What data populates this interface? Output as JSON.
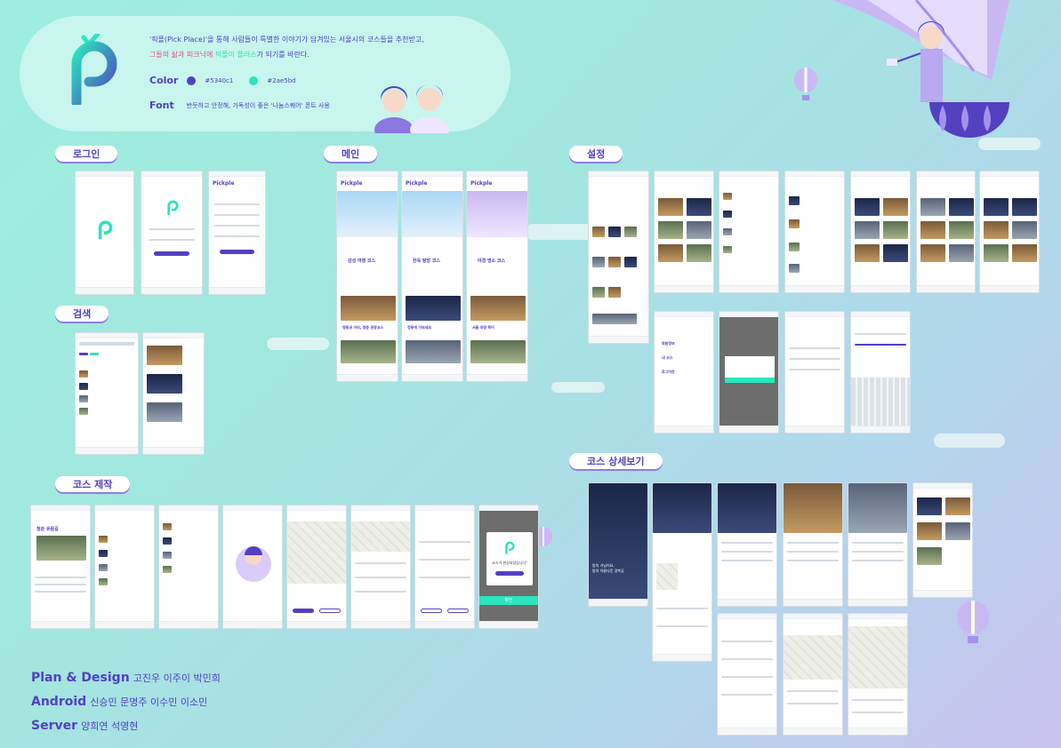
{
  "header": {
    "intro_line1": "'픽플(Pick Place)'을 통해 사람들이 특별한 이야기가 담겨있는 서울시의 코스들을 추천받고,",
    "intro_line2_a": "그들의 삶과 피크닉에 ",
    "intro_line2_b": "픽플이 플러스",
    "intro_line2_c": "가 되기를 바란다.",
    "color_label": "Color",
    "color_primary": "#5340c1",
    "color_secondary": "#2ae5bd",
    "font_label": "Font",
    "font_desc": "반듯하고 안정해, 가독성이 좋은 '나눔스퀘어' 폰트 사용"
  },
  "sections": {
    "login": "로그인",
    "main": "메인",
    "settings": "설정",
    "search": "검색",
    "course_make": "코스 제작",
    "course_detail": "코스 상세보기"
  },
  "app": {
    "logo_text": "Pickple",
    "main_cards": [
      "감성 여행 코스",
      "한옥 탐방 코스",
      "야경 명소 코스"
    ],
    "main_list": [
      "명동과 거리, 청춘 관광코스",
      "정동에 가보세요",
      "서울 야경 투어",
      "한옥 감성 코스"
    ],
    "detail_hero_line1": "밤의 거닐어요,",
    "detail_hero_line2": "밤의 아름다운 경복궁",
    "course_title": "청춘 유람길",
    "dialog_text": "코스가 완성되었습니다!",
    "dialog_button": "확인",
    "settings_menu": [
      "회원정보",
      "내 코스",
      "로그아웃"
    ]
  },
  "credits": [
    {
      "role": "Plan & Design",
      "names": "고진우 이주이 박민희"
    },
    {
      "role": "Android",
      "names": "신승민 문명주 이수민 이소민"
    },
    {
      "role": "Server",
      "names": "양희연 석영현"
    }
  ]
}
